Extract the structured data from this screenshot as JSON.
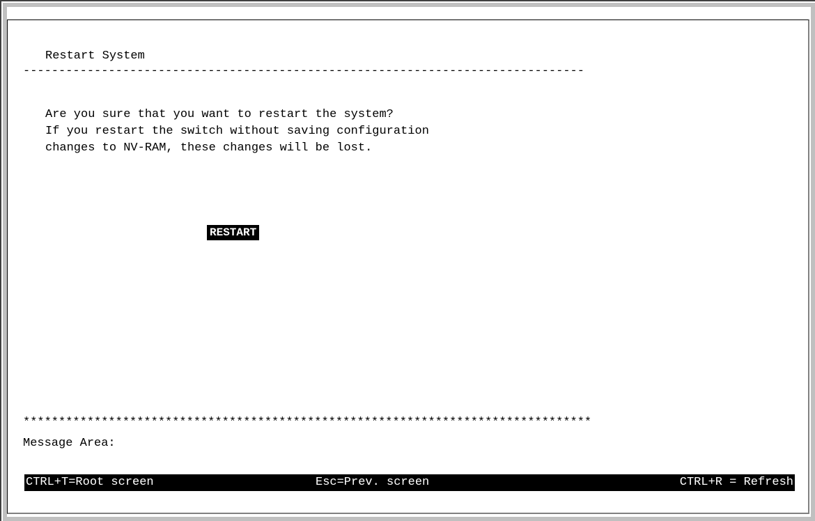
{
  "screen": {
    "title": "Restart System",
    "separator": "-------------------------------------------------------------------------------",
    "message_lines": [
      "Are you sure that you want to restart the system?",
      "If you restart the switch without saving configuration",
      "changes to NV-RAM, these changes will be lost."
    ],
    "restart_button_label": "RESTART",
    "stars_separator": "********************************************************************************",
    "message_area_label": "Message Area:"
  },
  "status_bar": {
    "root_hint": "CTRL+T=Root screen",
    "prev_hint": "Esc=Prev. screen",
    "refresh_hint": "CTRL+R = Refresh"
  },
  "colors": {
    "background": "#ffffff",
    "text": "#000000",
    "highlight_bg": "#000000",
    "highlight_text": "#ffffff",
    "frame": "#c0c0c0"
  }
}
